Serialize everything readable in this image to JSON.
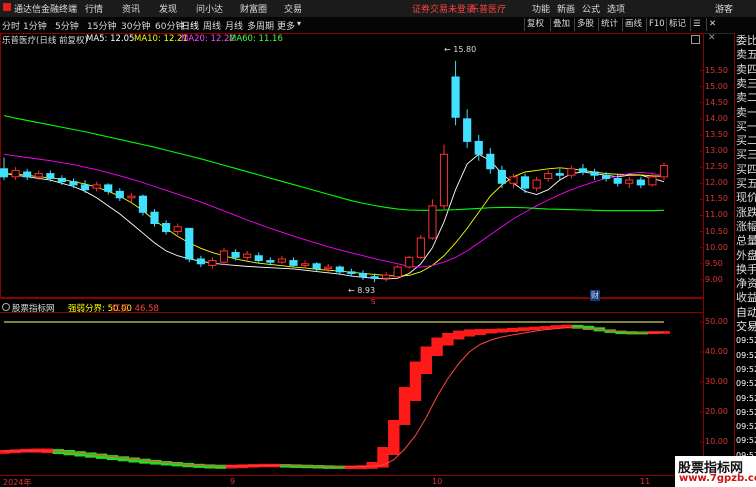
{
  "menubar": {
    "logo": "通达信金融终端",
    "items": [
      "行情",
      "资讯",
      "发现",
      "问小达",
      "财富圈",
      "交易"
    ],
    "login_status": "证券交易未登录",
    "stock": "乐普医疗",
    "right_items": [
      "功能",
      "新画",
      "公式",
      "选项"
    ],
    "user": "游客"
  },
  "tabbar": {
    "periods": [
      "分时",
      "1分钟",
      "5分钟",
      "15分钟",
      "30分钟",
      "60分钟",
      "日线",
      "周线",
      "月线",
      "多周期",
      "更多"
    ],
    "active": "日线",
    "tools": [
      "复权",
      "叠加",
      "多股",
      "统计",
      "画线",
      "F10",
      "标记"
    ]
  },
  "main": {
    "stock_title": "乐普医疗(日线 前复权)",
    "ma5": "MA5: 12.05",
    "ma10": "MA10: 12.21",
    "ma20": "MA20: 12.22",
    "ma60": "MA60: 11.16",
    "high_label": "15.80",
    "low_label": "8.93",
    "marker": "财",
    "bottom_flag": "S"
  },
  "sub": {
    "title": "股票指标网",
    "threshold": "强弱分界: 50.00",
    "value": "红买: 46.58"
  },
  "xaxis": [
    "2024年",
    "9",
    "10",
    "11"
  ],
  "right_panel": [
    "委比",
    "卖五",
    "卖四",
    "卖三",
    "卖二",
    "卖一",
    "买一",
    "买二",
    "买三",
    "买四",
    "买五",
    "现价",
    "涨跌",
    "涨幅",
    "总量",
    "外盘",
    "换手",
    "净资",
    "收益",
    "自动",
    "交易",
    "09:52",
    "09:52",
    "09:52",
    "09:52",
    "09:52",
    "09:52",
    "09:52",
    "09:52",
    "09:52",
    "09:52",
    "09:52"
  ],
  "watermark": {
    "title": "股票指标网",
    "url": "www.7gpzb.com"
  },
  "colors": {
    "up": "#ff3030",
    "down": "#40e0ff",
    "ma5": "#ffffff",
    "ma10": "#ffff00",
    "ma20": "#ff00ff",
    "ma60": "#00ff00"
  },
  "chart_data": [
    {
      "type": "candlestick",
      "title": "乐普医疗(日线 前复权)",
      "ylim": [
        8.5,
        16.2
      ],
      "yticks": [
        9.0,
        9.5,
        10.0,
        10.5,
        11.0,
        11.5,
        12.0,
        12.5,
        13.0,
        13.5,
        14.0,
        14.5,
        15.0,
        15.5
      ],
      "series": [
        {
          "name": "MA5",
          "values": [
            12.3,
            12.25,
            12.2,
            12.15,
            12.1,
            12.0,
            11.9,
            11.75,
            11.55,
            11.3,
            11.05,
            10.75,
            10.45,
            10.15,
            9.9,
            9.75,
            9.65,
            9.58,
            9.52,
            9.48,
            9.45,
            9.42,
            9.4,
            9.38,
            9.36,
            9.34,
            9.3,
            9.26,
            9.22,
            9.18,
            9.12,
            9.08,
            9.05,
            9.03,
            9.05,
            9.2,
            9.5,
            10.0,
            10.8,
            11.8,
            12.6,
            12.9,
            12.7,
            12.3,
            12.0,
            11.75,
            11.65,
            11.8,
            12.1,
            12.3,
            12.35,
            12.3,
            12.25,
            12.2,
            12.25,
            12.25,
            12.15,
            12.05
          ]
        },
        {
          "name": "MA10",
          "values": [
            12.3,
            12.28,
            12.25,
            12.2,
            12.17,
            12.12,
            12.05,
            11.98,
            11.88,
            11.75,
            11.6,
            11.4,
            11.15,
            10.85,
            10.6,
            10.35,
            10.15,
            9.98,
            9.85,
            9.75,
            9.65,
            9.58,
            9.52,
            9.48,
            9.44,
            9.4,
            9.37,
            9.33,
            9.3,
            9.27,
            9.24,
            9.2,
            9.17,
            9.14,
            9.12,
            9.14,
            9.25,
            9.45,
            9.75,
            10.15,
            10.6,
            11.1,
            11.6,
            11.95,
            12.2,
            12.35,
            12.4,
            12.45,
            12.48,
            12.45,
            12.4,
            12.35,
            12.3,
            12.28,
            12.27,
            12.26,
            12.23,
            12.21
          ]
        },
        {
          "name": "MA20",
          "values": [
            12.9,
            12.85,
            12.8,
            12.75,
            12.7,
            12.64,
            12.58,
            12.5,
            12.42,
            12.33,
            12.23,
            12.13,
            12.02,
            11.9,
            11.78,
            11.66,
            11.54,
            11.42,
            11.28,
            11.14,
            11.0,
            10.86,
            10.73,
            10.6,
            10.48,
            10.36,
            10.25,
            10.14,
            10.03,
            9.93,
            9.84,
            9.75,
            9.66,
            9.58,
            9.5,
            9.42,
            9.4,
            9.45,
            9.55,
            9.7,
            9.9,
            10.15,
            10.4,
            10.65,
            10.9,
            11.1,
            11.3,
            11.48,
            11.65,
            11.8,
            11.93,
            12.05,
            12.15,
            12.22,
            12.3,
            12.34,
            12.3,
            12.22
          ]
        },
        {
          "name": "MA60",
          "values": [
            14.1,
            14.02,
            13.95,
            13.88,
            13.81,
            13.74,
            13.67,
            13.6,
            13.52,
            13.44,
            13.36,
            13.28,
            13.2,
            13.12,
            13.03,
            12.94,
            12.85,
            12.76,
            12.66,
            12.56,
            12.46,
            12.36,
            12.26,
            12.16,
            12.06,
            11.96,
            11.86,
            11.76,
            11.66,
            11.56,
            11.46,
            11.38,
            11.31,
            11.25,
            11.2,
            11.17,
            11.16,
            11.16,
            11.17,
            11.18,
            11.2,
            11.22,
            11.24,
            11.25,
            11.25,
            11.24,
            11.22,
            11.2,
            11.19,
            11.18,
            11.17,
            11.16,
            11.15,
            11.15,
            11.15,
            11.15,
            11.15,
            11.16
          ]
        }
      ],
      "candles": [
        [
          12.45,
          12.2,
          12.8,
          12.1
        ],
        [
          12.2,
          12.4,
          12.5,
          12.1
        ],
        [
          12.35,
          12.2,
          12.45,
          12.1
        ],
        [
          12.2,
          12.3,
          12.4,
          12.1
        ],
        [
          12.3,
          12.15,
          12.4,
          12.05
        ],
        [
          12.15,
          12.05,
          12.25,
          11.95
        ],
        [
          12.05,
          11.95,
          12.15,
          11.85
        ],
        [
          11.95,
          11.8,
          12.1,
          11.7
        ],
        [
          11.85,
          11.95,
          12.05,
          11.75
        ],
        [
          11.95,
          11.75,
          12.0,
          11.65
        ],
        [
          11.75,
          11.55,
          11.85,
          11.45
        ],
        [
          11.55,
          11.6,
          11.7,
          11.4
        ],
        [
          11.6,
          11.1,
          11.65,
          11.0
        ],
        [
          11.1,
          10.75,
          11.2,
          10.65
        ],
        [
          10.75,
          10.5,
          10.85,
          10.4
        ],
        [
          10.5,
          10.65,
          10.75,
          10.4
        ],
        [
          10.6,
          9.65,
          10.6,
          9.55
        ],
        [
          9.65,
          9.5,
          9.75,
          9.4
        ],
        [
          9.45,
          9.6,
          9.7,
          9.35
        ],
        [
          9.55,
          9.9,
          10.0,
          9.45
        ],
        [
          9.85,
          9.7,
          9.95,
          9.6
        ],
        [
          9.7,
          9.8,
          9.9,
          9.6
        ],
        [
          9.75,
          9.6,
          9.85,
          9.5
        ],
        [
          9.6,
          9.55,
          9.7,
          9.45
        ],
        [
          9.55,
          9.65,
          9.75,
          9.5
        ],
        [
          9.6,
          9.45,
          9.7,
          9.4
        ],
        [
          9.45,
          9.5,
          9.6,
          9.35
        ],
        [
          9.5,
          9.35,
          9.55,
          9.25
        ],
        [
          9.35,
          9.4,
          9.5,
          9.25
        ],
        [
          9.4,
          9.25,
          9.45,
          9.15
        ],
        [
          9.25,
          9.2,
          9.35,
          9.1
        ],
        [
          9.2,
          9.1,
          9.3,
          9.0
        ],
        [
          9.1,
          9.05,
          9.2,
          8.93
        ],
        [
          9.05,
          9.15,
          9.25,
          8.95
        ],
        [
          9.1,
          9.4,
          9.45,
          9.05
        ],
        [
          9.4,
          9.7,
          9.75,
          9.35
        ],
        [
          9.7,
          10.3,
          10.4,
          9.65
        ],
        [
          10.3,
          11.3,
          11.5,
          10.25
        ],
        [
          11.3,
          12.9,
          13.2,
          11.2
        ],
        [
          15.3,
          14.05,
          15.8,
          13.8
        ],
        [
          14.0,
          13.3,
          14.3,
          13.1
        ],
        [
          13.3,
          12.9,
          13.5,
          12.7
        ],
        [
          12.9,
          12.45,
          13.1,
          12.3
        ],
        [
          12.4,
          12.0,
          12.55,
          11.85
        ],
        [
          12.0,
          12.2,
          12.3,
          11.85
        ],
        [
          12.2,
          11.85,
          12.3,
          11.7
        ],
        [
          11.85,
          12.1,
          12.2,
          11.75
        ],
        [
          12.15,
          12.3,
          12.4,
          12.05
        ],
        [
          12.3,
          12.25,
          12.45,
          12.1
        ],
        [
          12.25,
          12.45,
          12.55,
          12.15
        ],
        [
          12.45,
          12.35,
          12.6,
          12.25
        ],
        [
          12.35,
          12.25,
          12.45,
          12.1
        ],
        [
          12.25,
          12.15,
          12.35,
          12.05
        ],
        [
          12.15,
          12.0,
          12.3,
          11.9
        ],
        [
          12.0,
          12.1,
          12.2,
          11.85
        ],
        [
          12.1,
          11.95,
          12.2,
          11.85
        ],
        [
          11.95,
          12.2,
          12.3,
          11.9
        ],
        [
          12.2,
          12.55,
          12.65,
          12.1
        ]
      ]
    },
    {
      "type": "area",
      "title": "股票指标网",
      "ylim": [
        0,
        52
      ],
      "yticks": [
        10,
        20,
        30,
        40,
        50
      ],
      "threshold": 50,
      "series": [
        {
          "name": "upper",
          "values": [
            7.0,
            7.2,
            7.4,
            7.5,
            7.5,
            7.3,
            7.0,
            6.6,
            6.2,
            5.8,
            5.3,
            4.9,
            4.5,
            4.1,
            3.7,
            3.3,
            3.0,
            2.7,
            2.4,
            2.2,
            2.1,
            2.1,
            2.2,
            2.3,
            2.4,
            2.4,
            2.3,
            2.2,
            2.1,
            2.0,
            1.9,
            1.8,
            1.8,
            1.9,
            3.0,
            8.0,
            17.0,
            28.0,
            36.5,
            41.5,
            44.5,
            46.0,
            46.8,
            47.2,
            47.3,
            47.4,
            47.5,
            47.7,
            47.9,
            48.1,
            48.3,
            48.6,
            48.8,
            48.7,
            48.4,
            47.9,
            47.2,
            46.8,
            46.6,
            46.5,
            46.6,
            46.6
          ]
        },
        {
          "name": "lower",
          "values": [
            6.4,
            6.6,
            6.8,
            6.8,
            6.6,
            6.3,
            5.9,
            5.5,
            5.1,
            4.7,
            4.3,
            3.9,
            3.5,
            3.1,
            2.8,
            2.5,
            2.2,
            1.9,
            1.7,
            1.5,
            1.4,
            1.5,
            1.6,
            1.8,
            1.9,
            1.9,
            1.8,
            1.7,
            1.6,
            1.5,
            1.4,
            1.4,
            1.3,
            1.3,
            1.4,
            1.8,
            6.0,
            16.0,
            24.0,
            33.0,
            39.0,
            42.5,
            44.5,
            45.5,
            46.0,
            46.5,
            46.8,
            47.0,
            47.3,
            47.6,
            47.9,
            48.2,
            48.3,
            48.1,
            47.7,
            47.2,
            46.7,
            46.3,
            46.2,
            46.2,
            46.3,
            46.4
          ]
        },
        {
          "name": "signal",
          "values": [
            7.0,
            7.0,
            7.1,
            7.1,
            7.0,
            6.9,
            6.6,
            6.3,
            5.9,
            5.5,
            5.1,
            4.7,
            4.3,
            3.9,
            3.5,
            3.1,
            2.8,
            2.5,
            2.3,
            2.1,
            2.0,
            2.0,
            2.0,
            2.1,
            2.1,
            2.2,
            2.2,
            2.1,
            2.0,
            1.9,
            1.9,
            1.8,
            1.8,
            1.8,
            1.9,
            2.3,
            4.0,
            7.5,
            12.0,
            18.0,
            25.0,
            31.0,
            36.0,
            40.0,
            42.5,
            44.0,
            45.0,
            45.7,
            46.3,
            46.9,
            47.4,
            47.8,
            48.1,
            48.1,
            47.9,
            47.5,
            47.1,
            46.8,
            46.6,
            46.5,
            46.5,
            46.6
          ]
        }
      ]
    }
  ]
}
